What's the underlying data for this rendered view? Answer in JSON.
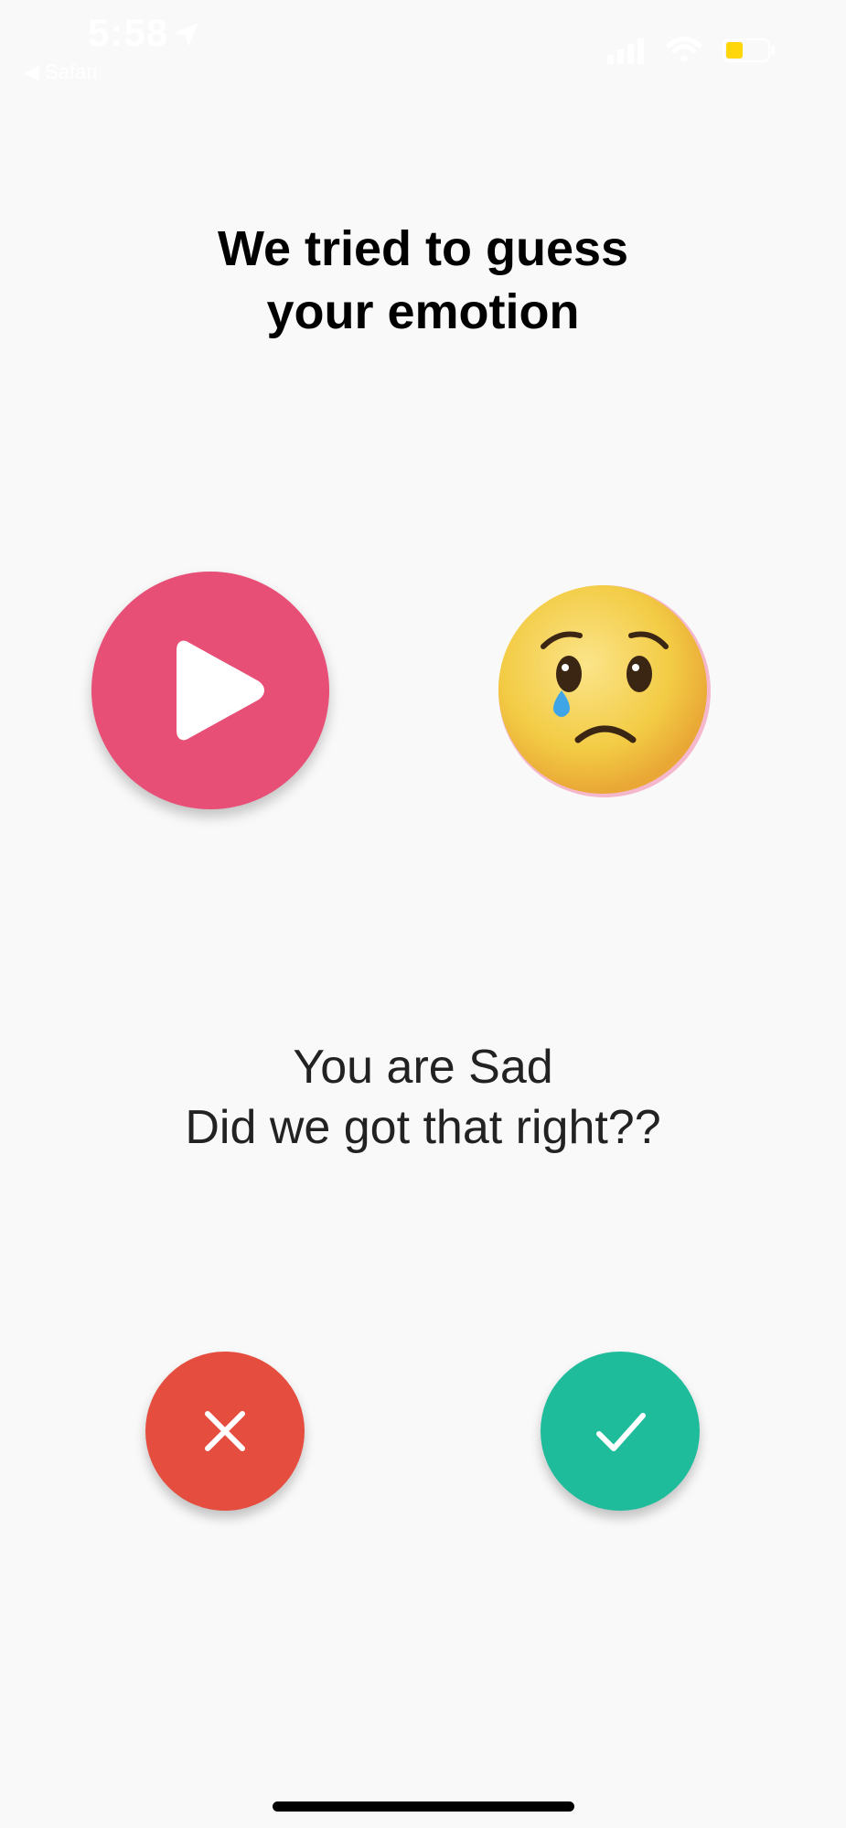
{
  "status_bar": {
    "time": "5:58",
    "back_app": "◀ Safari",
    "icons": [
      "location-arrow-icon",
      "cellular-signal-icon",
      "wifi-icon",
      "battery-icon"
    ],
    "battery_color": "#ffd60a"
  },
  "screen": {
    "title_line1": "We tried to guess",
    "title_line2": "your emotion",
    "play_button_icon": "play-icon",
    "play_button_color": "#e84f76",
    "emotion_emoji": "crying-face-emoji",
    "message_line1": "You are Sad",
    "message_line2": "Did we got that right??",
    "reject_button_icon": "close-icon",
    "reject_button_color": "#e54d3f",
    "accept_button_icon": "checkmark-icon",
    "accept_button_color": "#1fbc9c"
  }
}
